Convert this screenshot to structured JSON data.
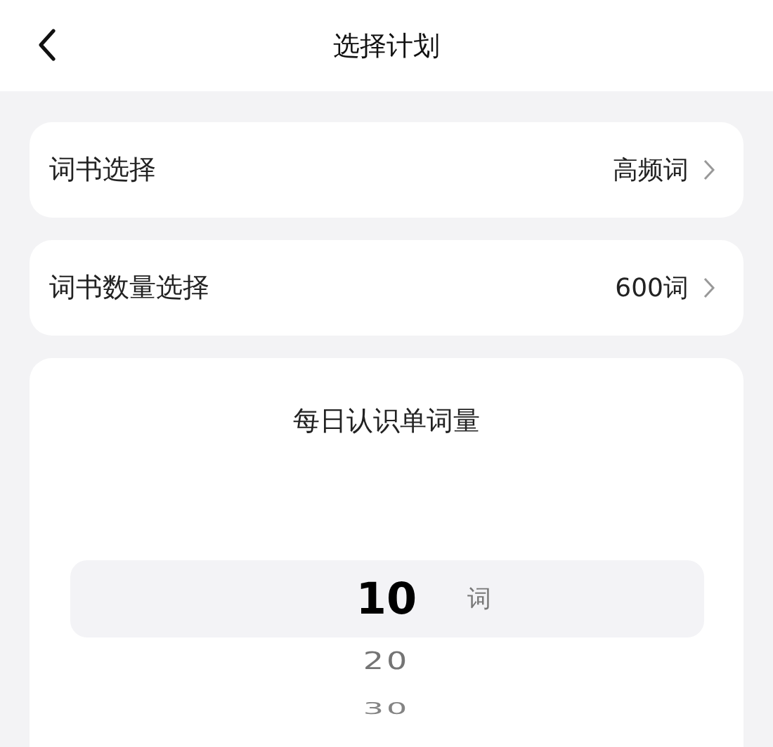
{
  "header": {
    "title": "选择计划"
  },
  "settings": [
    {
      "label": "词书选择",
      "value": "高频词"
    },
    {
      "label": "词书数量选择",
      "value": "600词"
    }
  ],
  "picker": {
    "title": "每日认识单词量",
    "unit": "词",
    "options": [
      {
        "value": "10",
        "selected": true
      },
      {
        "value": "20",
        "selected": false
      },
      {
        "value": "30",
        "selected": false
      }
    ]
  }
}
